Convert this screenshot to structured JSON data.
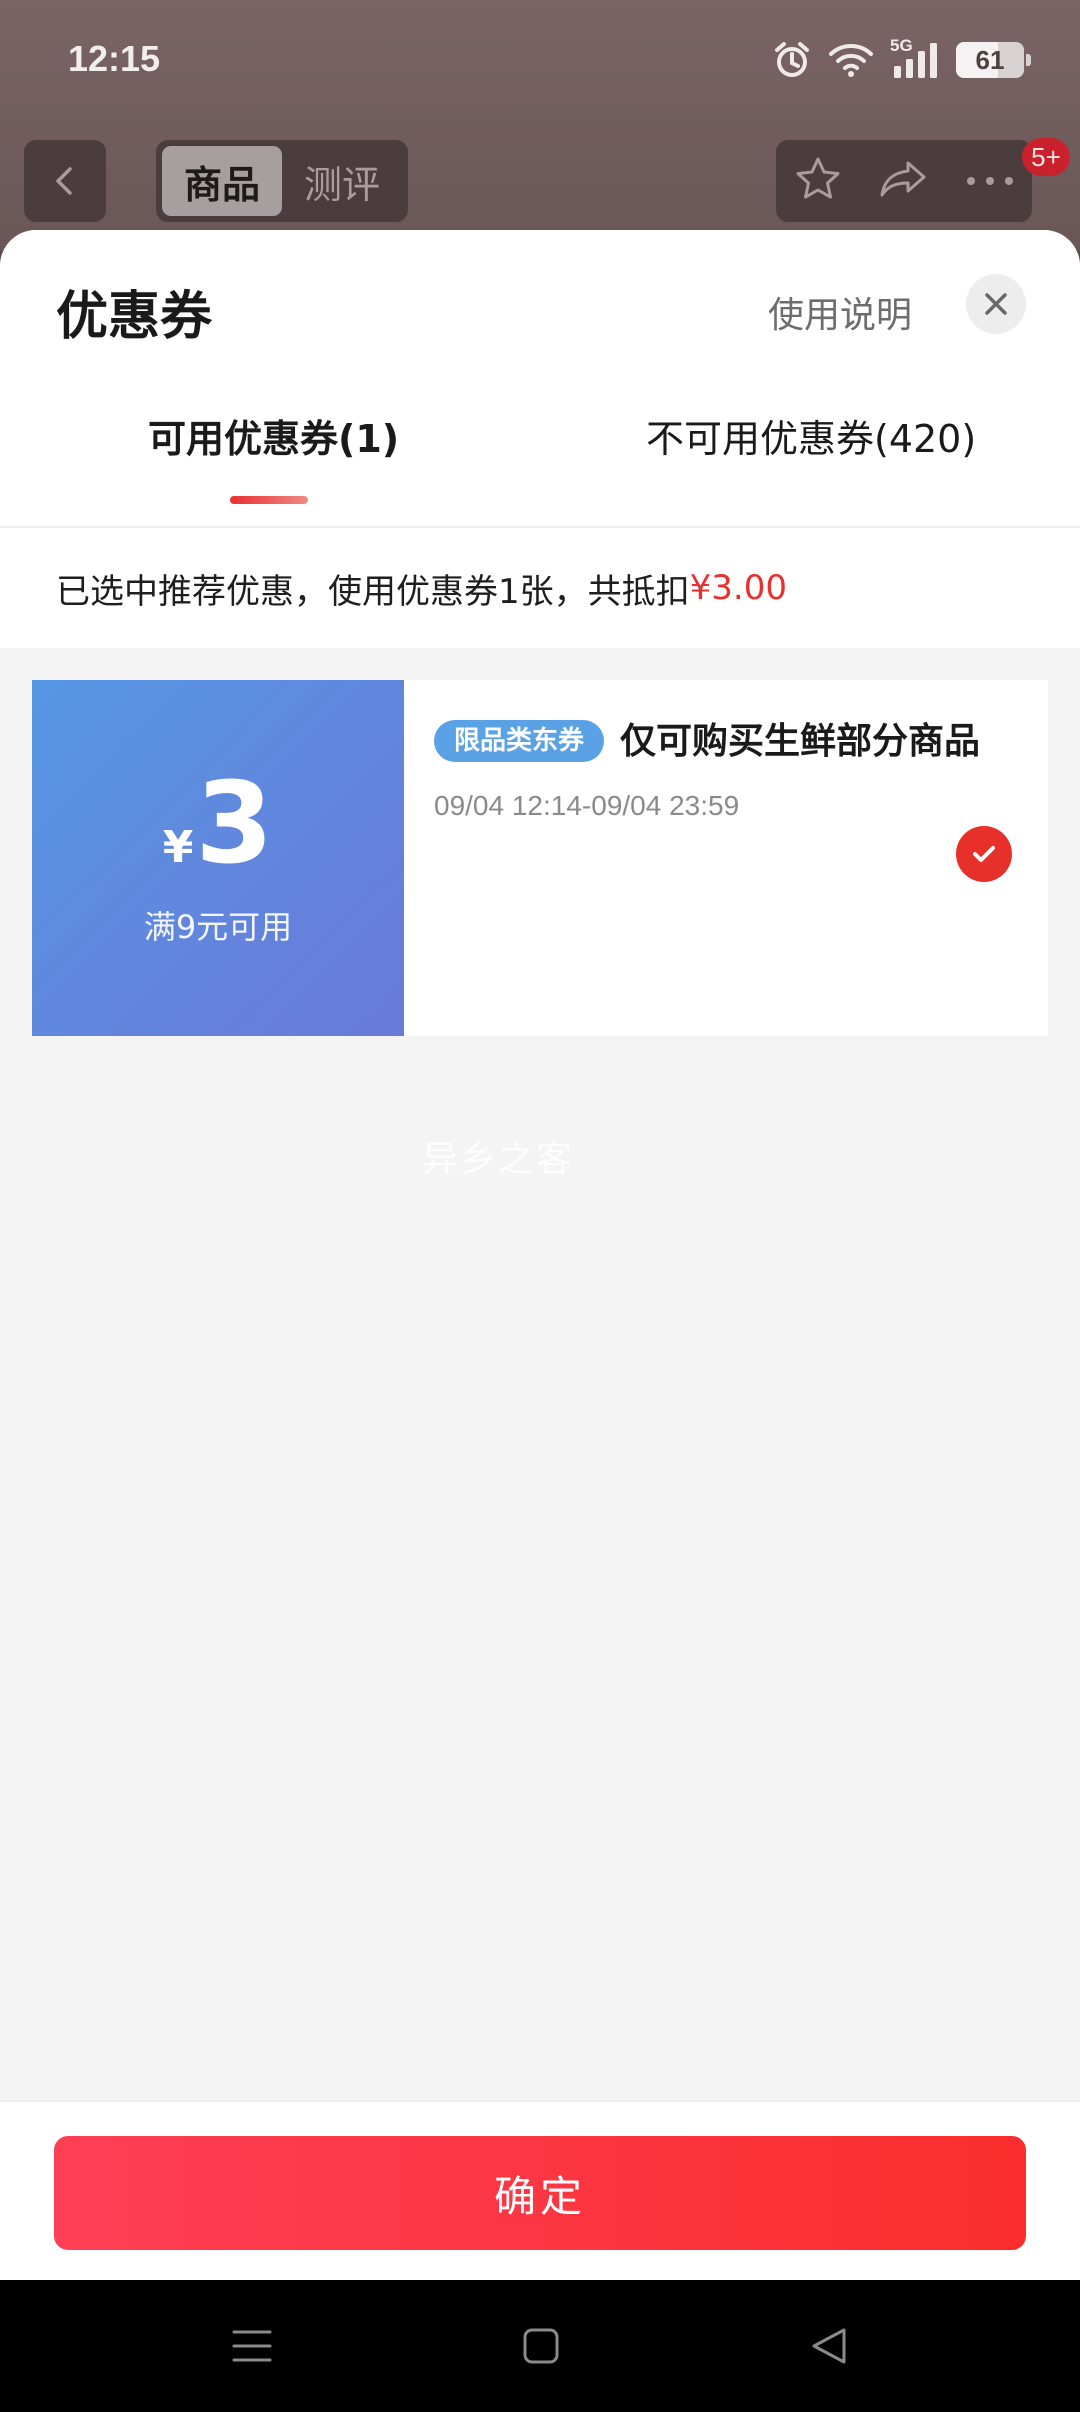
{
  "status_bar": {
    "time": "12:15",
    "network": "5G",
    "battery": "61",
    "icons": [
      "alarm-icon",
      "wifi-icon",
      "signal-icon",
      "battery-icon"
    ]
  },
  "product_header": {
    "tabs": [
      "商品",
      "测评"
    ],
    "active_tab": 0,
    "badge": "5+",
    "icons": [
      "back-icon",
      "star-icon",
      "share-icon",
      "more-icon"
    ]
  },
  "sheet": {
    "title": "优惠券",
    "help_link": "使用说明",
    "tabs": [
      {
        "label": "可用优惠券(1)",
        "active": true
      },
      {
        "label": "不可用优惠券(420)",
        "active": false
      }
    ],
    "summary_prefix": "已选中推荐优惠，使用优惠券1张，共抵扣",
    "summary_amount": "¥3.00"
  },
  "coupons": [
    {
      "currency": "¥",
      "amount": "3",
      "threshold": "满9元可用",
      "tag": "限品类东券",
      "title": "仅可购买生鲜部分商品",
      "validity": "09/04 12:14-09/04 23:59",
      "selected": true
    }
  ],
  "watermark": "异乡之客",
  "footer": {
    "confirm_label": "确定"
  },
  "colors": {
    "accent": "#e8302e",
    "coupon_gradient_start": "#5697e2",
    "coupon_gradient_end": "#6a79d9",
    "tag_bg": "#5aa1e6"
  }
}
